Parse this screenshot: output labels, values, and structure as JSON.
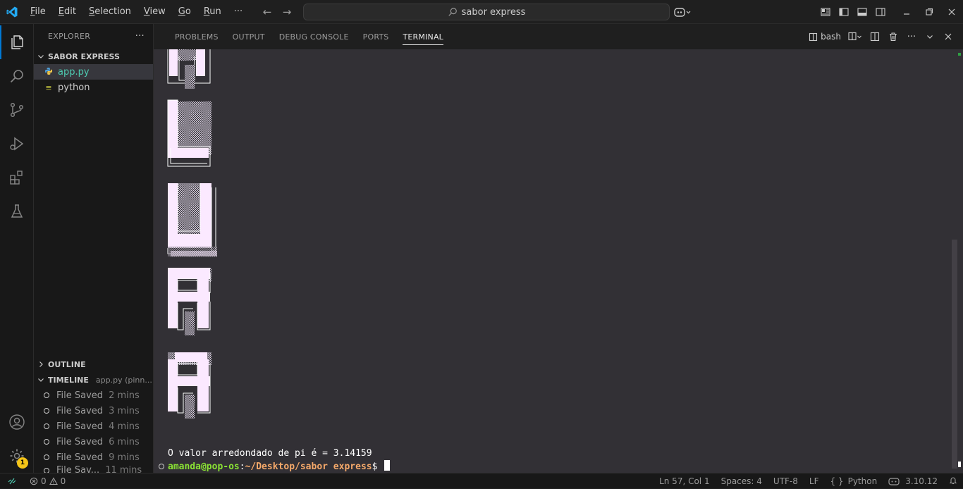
{
  "menu": [
    "File",
    "Edit",
    "Selection",
    "View",
    "Go",
    "Run"
  ],
  "menu_underline": [
    "F",
    "E",
    "S",
    "V",
    "G",
    "R"
  ],
  "menu_more": "···",
  "search": {
    "text": "sabor express"
  },
  "explorer": {
    "title": "EXPLORER",
    "more": "···",
    "folder": "SABOR EXPRESS",
    "files": [
      {
        "name": "app.py",
        "icon": "python-file-icon",
        "selected": true
      },
      {
        "name": "python",
        "icon": "text-file-icon",
        "selected": false
      }
    ]
  },
  "outline": {
    "title": "OUTLINE"
  },
  "timeline": {
    "title": "TIMELINE",
    "subtitle": "app.py (pinn...",
    "items": [
      {
        "label": "File Saved",
        "time": "2 mins"
      },
      {
        "label": "File Saved",
        "time": "3 mins"
      },
      {
        "label": "File Saved",
        "time": "4 mins"
      },
      {
        "label": "File Saved",
        "time": "6 mins"
      },
      {
        "label": "File Saved",
        "time": "9 mins"
      },
      {
        "label": "File Sav...",
        "time": "11 mins"
      }
    ]
  },
  "panel": {
    "tabs": [
      "PROBLEMS",
      "OUTPUT",
      "DEBUG CONSOLE",
      "PORTS",
      "TERMINAL"
    ],
    "active_tab": "TERMINAL",
    "shell": "bash"
  },
  "terminal": {
    "ascii_letters": [
      "L",
      "U",
      "R",
      "A"
    ],
    "output_line": "O valor arredondado de pi é = 3.14159",
    "prompt_user": "amanda@pop-os",
    "prompt_sep": ":",
    "prompt_path": "~/Desktop/sabor express",
    "prompt_symbol": "$ "
  },
  "status": {
    "errors": "0",
    "warnings": "0",
    "position": "Ln 57, Col 1",
    "spaces": "Spaces: 4",
    "encoding": "UTF-8",
    "eol": "LF",
    "language": "Python",
    "language_icon": "{ }",
    "version": "3.10.12"
  },
  "settings_badge": "1",
  "colors": {
    "accent": "#0078d4",
    "terminal_bg": "#323035",
    "prompt_user": "#8ae234",
    "prompt_path": "#f5a96a",
    "letter_fill": "#fbe9ff"
  }
}
